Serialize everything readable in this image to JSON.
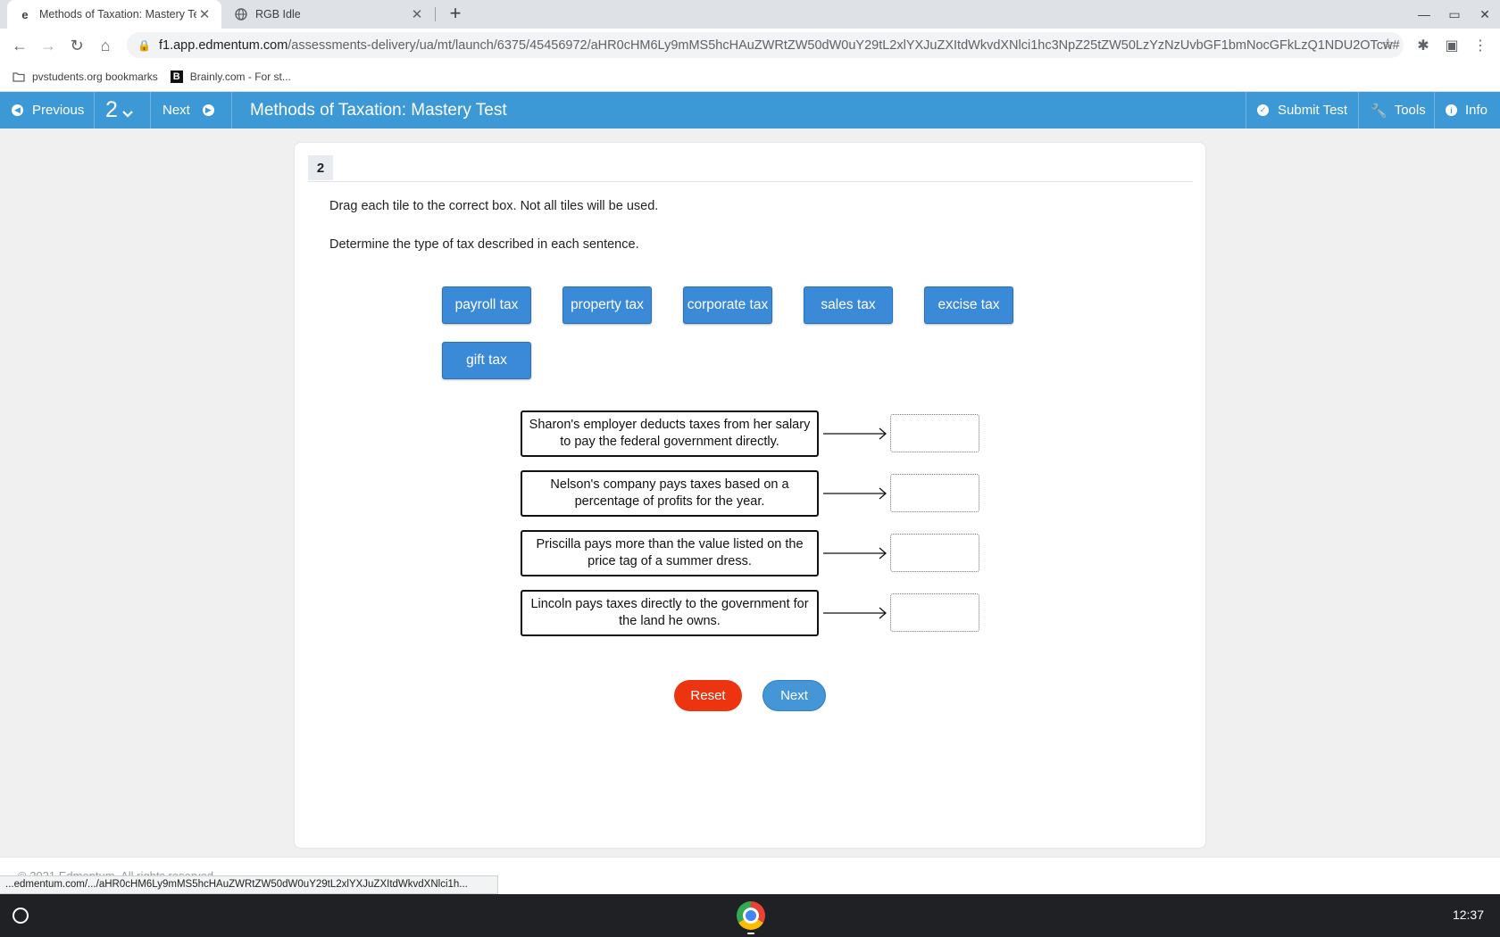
{
  "browser": {
    "tabs": [
      {
        "title": "Methods of Taxation: Mastery Te",
        "favicon": "e"
      },
      {
        "title": "RGB Idle",
        "favicon": "globe-icon"
      }
    ],
    "url_host": "f1.app.edmentum.com",
    "url_path": "/assessments-delivery/ua/mt/launch/6375/45456972/aHR0cHM6Ly9mMS5hcHAuZWRtZW50dW0uY29tL2xlYXJuZXItdWkvdXNlci1hc3NpZ25tZW50LzYzNzUvbGF1bmNocGFkLzQ1NDU2OTcw#",
    "bookmarks": [
      {
        "label": "pvstudents.org bookmarks",
        "icon": "folder-icon"
      },
      {
        "label": "Brainly.com - For st...",
        "icon": "brainly-logo"
      }
    ],
    "status_url": "...edmentum.com/.../aHR0cHM6Ly9mMS5hcHAuZWRtZW50dW0uY29tL2xlYXJuZXItdWkvdXNlci1h..."
  },
  "appbar": {
    "previous": "Previous",
    "question_number": "2",
    "next": "Next",
    "title": "Methods of Taxation: Mastery Test",
    "submit": "Submit Test",
    "tools": "Tools",
    "info": "Info",
    "color": "#3d99d5"
  },
  "question": {
    "number": "2",
    "instruction": "Drag each tile to the correct box. Not all tiles will be used.",
    "prompt": "Determine the type of tax described in each sentence.",
    "tiles": [
      "payroll tax",
      "property tax",
      "corporate tax",
      "sales tax",
      "excise tax",
      "gift tax"
    ],
    "statements": [
      "Sharon's employer deducts taxes from her salary to pay the federal government directly.",
      "Nelson's company pays taxes based on a percentage of profits for the year.",
      "Priscilla pays more than the value listed on the price tag of a summer dress.",
      "Lincoln pays taxes directly to the government for the land he owns."
    ],
    "reset_label": "Reset",
    "next_label": "Next"
  },
  "footer": {
    "copyright": "© 2021 Edmentum. All rights reserved."
  },
  "shelf": {
    "time": "12:37"
  }
}
